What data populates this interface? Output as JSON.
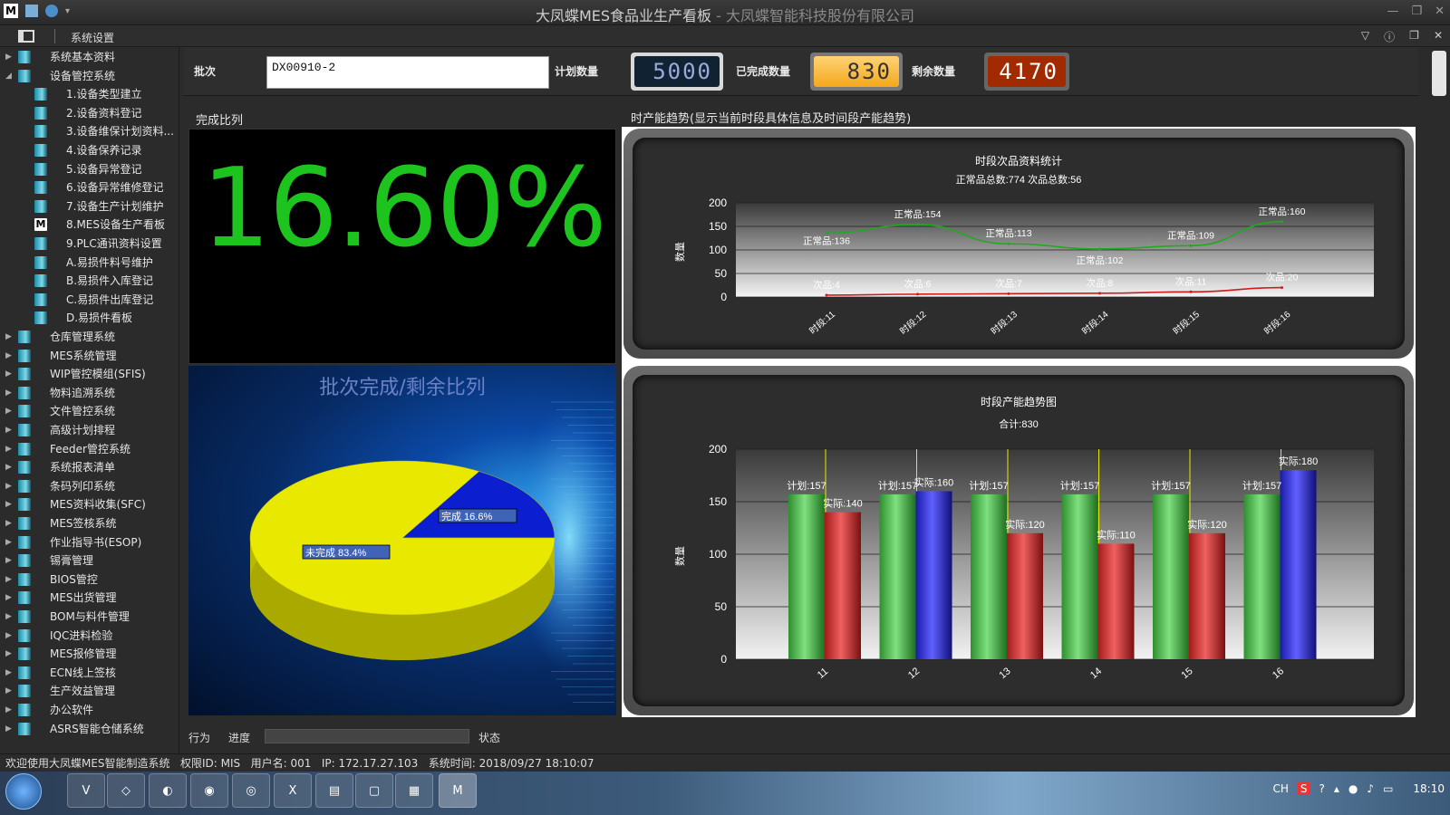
{
  "window": {
    "title": "大凤蝶MES食品业生产看板",
    "subtitle": " - 大凤蝶智能科技股份有限公司",
    "menu": "系统设置"
  },
  "sidebar": {
    "items": [
      {
        "label": "系统基本资料",
        "level": 0,
        "expanded": false
      },
      {
        "label": "设备管控系统",
        "level": 0,
        "expanded": true
      },
      {
        "label": "1.设备类型建立",
        "level": 1
      },
      {
        "label": "2.设备资料登记",
        "level": 1
      },
      {
        "label": "3.设备维保计划资料...",
        "level": 1
      },
      {
        "label": "4.设备保养记录",
        "level": 1
      },
      {
        "label": "5.设备异常登记",
        "level": 1
      },
      {
        "label": "6.设备异常维修登记",
        "level": 1
      },
      {
        "label": "7.设备生产计划维护",
        "level": 1
      },
      {
        "label": "8.MES设备生产看板",
        "level": 1,
        "mes": true
      },
      {
        "label": "9.PLC通讯资料设置",
        "level": 1
      },
      {
        "label": "A.易损件料号维护",
        "level": 1
      },
      {
        "label": "B.易损件入库登记",
        "level": 1
      },
      {
        "label": "C.易损件出库登记",
        "level": 1
      },
      {
        "label": "D.易损件看板",
        "level": 1
      },
      {
        "label": "仓库管理系统",
        "level": 0,
        "expanded": false
      },
      {
        "label": "MES系统管理",
        "level": 0,
        "expanded": false
      },
      {
        "label": "WIP管控模组(SFIS)",
        "level": 0,
        "expanded": false
      },
      {
        "label": "物料追溯系统",
        "level": 0,
        "expanded": false
      },
      {
        "label": "文件管控系统",
        "level": 0,
        "expanded": false
      },
      {
        "label": "高级计划排程",
        "level": 0,
        "expanded": false
      },
      {
        "label": "Feeder管控系统",
        "level": 0,
        "expanded": false
      },
      {
        "label": "系统报表清单",
        "level": 0,
        "expanded": false
      },
      {
        "label": "条码列印系统",
        "level": 0,
        "expanded": false
      },
      {
        "label": "MES资料收集(SFC)",
        "level": 0,
        "expanded": false
      },
      {
        "label": "MES签核系统",
        "level": 0,
        "expanded": false
      },
      {
        "label": "作业指导书(ESOP)",
        "level": 0,
        "expanded": false
      },
      {
        "label": "锡膏管理",
        "level": 0,
        "expanded": false
      },
      {
        "label": "BIOS管控",
        "level": 0,
        "expanded": false
      },
      {
        "label": "MES出货管理",
        "level": 0,
        "expanded": false
      },
      {
        "label": "BOM与料件管理",
        "level": 0,
        "expanded": false
      },
      {
        "label": "IQC进料检验",
        "level": 0,
        "expanded": false
      },
      {
        "label": "MES报修管理",
        "level": 0,
        "expanded": false
      },
      {
        "label": "ECN线上签核",
        "level": 0,
        "expanded": false
      },
      {
        "label": "生产效益管理",
        "level": 0,
        "expanded": false
      },
      {
        "label": "办公软件",
        "level": 0,
        "expanded": false
      },
      {
        "label": "ASRS智能仓储系统",
        "level": 0,
        "expanded": false
      }
    ]
  },
  "topbar": {
    "batch_label": "批次",
    "batch_value": "DX00910-2",
    "plan_label": "计划数量",
    "plan_value": "5000",
    "done_label": "已完成数量",
    "done_value": "830",
    "left_label": "剩余数量",
    "left_value": "4170"
  },
  "panels": {
    "ratio_title": "完成比列",
    "trend_title": "时产能趋势(显示当前时段具体信息及时间段产能趋势)",
    "percent": "16.60%",
    "pie_title": "批次完成/剩余比列"
  },
  "pie": {
    "type": "pie",
    "slices": [
      {
        "label": "完成 16.6%",
        "value": 16.6,
        "color": "#0b1fd0"
      },
      {
        "label": "未完成 83.4%",
        "value": 83.4,
        "color": "#e8e800"
      }
    ]
  },
  "chart_data": [
    {
      "type": "line",
      "title": "时段次品资料统计",
      "subtitle": "正常品总数:774 次品总数:56",
      "ylabel": "数量",
      "ylim": [
        0,
        200
      ],
      "yticks": [
        "200",
        "150",
        "100",
        "50",
        "0"
      ],
      "categories": [
        "时段:11",
        "时段:12",
        "时段:13",
        "时段:14",
        "时段:15",
        "时段:16"
      ],
      "series": [
        {
          "name": "正常品",
          "values": [
            136,
            154,
            113,
            102,
            109,
            160
          ],
          "labels": [
            "正常品:136",
            "正常品:154",
            "正常品:113",
            "正常品:102",
            "正常品:109",
            "正常品:160"
          ],
          "color": "#1faa1f"
        },
        {
          "name": "次品",
          "values": [
            4,
            6,
            7,
            8,
            11,
            20
          ],
          "labels": [
            "次品:4",
            "次品:6",
            "次品:7",
            "次品:8",
            "次品:11",
            "次品:20"
          ],
          "color": "#d21a1a"
        }
      ]
    },
    {
      "type": "bar",
      "title": "时段产能趋势图",
      "subtitle": "合计:830",
      "ylabel": "数量",
      "ylim": [
        0,
        200
      ],
      "yticks": [
        "200",
        "150",
        "100",
        "50",
        "0"
      ],
      "categories": [
        "11",
        "12",
        "13",
        "14",
        "15",
        "16"
      ],
      "series": [
        {
          "name": "计划",
          "values": [
            157,
            157,
            157,
            157,
            157,
            157
          ],
          "labels": [
            "计划:157",
            "计划:157",
            "计划:157",
            "计划:157",
            "计划:157",
            "计划:157"
          ]
        },
        {
          "name": "实际",
          "values": [
            140,
            160,
            120,
            110,
            120,
            180
          ],
          "labels": [
            "实际:140",
            "实际:160",
            "实际:120",
            "实际:110",
            "实际:120",
            "实际:180"
          ]
        }
      ]
    }
  ],
  "status": {
    "action": "行为",
    "progress": "进度",
    "state": "状态"
  },
  "footer": {
    "welcome": "欢迎使用大凤蝶MES智能制造系统",
    "perm": "权限ID: MIS",
    "user": "用户名: 001",
    "ip": "IP: 172.17.27.103",
    "time": "系统时间: 2018/09/27 18:10:07"
  },
  "taskbar": {
    "lang": "CH",
    "clock": "18:10"
  }
}
